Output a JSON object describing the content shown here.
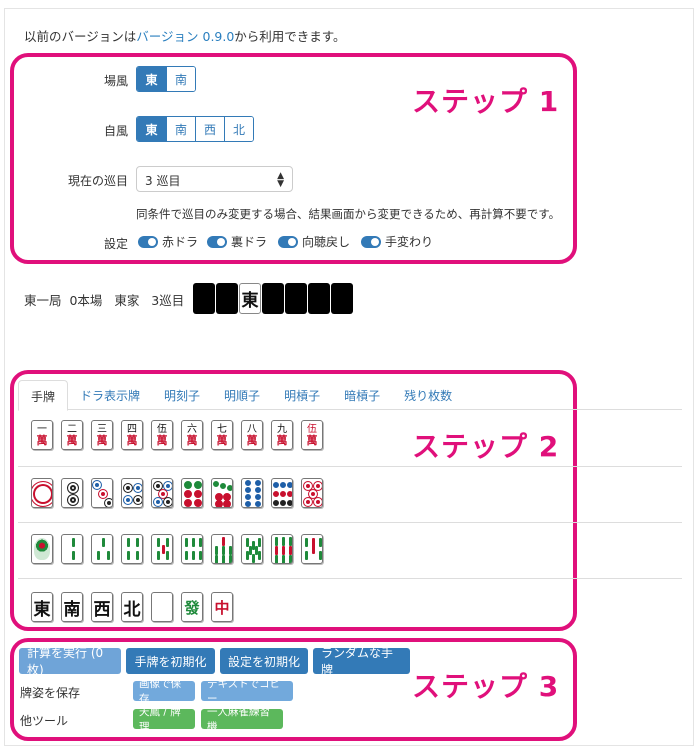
{
  "note": {
    "prefix": "以前のバージョンは",
    "link": "バージョン 0.9.0",
    "suffix": "から利用できます。"
  },
  "bakaze": {
    "label": "場風",
    "options": [
      "東",
      "南"
    ],
    "selected": "東"
  },
  "jikaze": {
    "label": "自風",
    "options": [
      "東",
      "南",
      "西",
      "北"
    ],
    "selected": "東"
  },
  "turn": {
    "label": "現在の巡目",
    "value": "3 巡目"
  },
  "help_text": "同条件で巡目のみ変更する場合、結果画面から変更できるため、再計算不要です。",
  "settings": {
    "label": "設定",
    "toggles": [
      "赤ドラ",
      "裏ドラ",
      "向聴戻し",
      "手変わり"
    ]
  },
  "round_info": "東一局  0本場   東家   3巡目",
  "hand_tiles": [
    "",
    "",
    "東",
    "",
    "",
    "",
    ""
  ],
  "tabs": [
    "手牌",
    "ドラ表示牌",
    "明刻子",
    "明順子",
    "明槓子",
    "暗槓子",
    "残り枚数"
  ],
  "man_tiles": [
    {
      "num": "一",
      "ch": "萬"
    },
    {
      "num": "二",
      "ch": "萬"
    },
    {
      "num": "三",
      "ch": "萬"
    },
    {
      "num": "四",
      "ch": "萬"
    },
    {
      "num": "伍",
      "ch": "萬"
    },
    {
      "num": "六",
      "ch": "萬"
    },
    {
      "num": "七",
      "ch": "萬"
    },
    {
      "num": "八",
      "ch": "萬"
    },
    {
      "num": "九",
      "ch": "萬"
    },
    {
      "num": "伍",
      "ch": "萬"
    }
  ],
  "honor_tiles": [
    "東",
    "南",
    "西",
    "北",
    "",
    "發",
    "中"
  ],
  "buttons": {
    "calc": "計算を実行 (0枚)",
    "reset_hand": "手牌を初期化",
    "reset_settings": "設定を初期化",
    "random_hand": "ランダムな手牌"
  },
  "save": {
    "label": "牌姿を保存",
    "image": "画像で保存",
    "text": "テキストでコピー"
  },
  "tools": {
    "label": "他ツール",
    "tenhou": "天鳳 / 牌理",
    "practice": "一人麻雀練習機"
  },
  "steps": [
    "ステップ 1",
    "ステップ 2",
    "ステップ 3"
  ],
  "colors": {
    "accent": "#337ab7",
    "annotation": "#e0107b",
    "green": "#5cb85c",
    "red_tile": "#c8102e"
  }
}
